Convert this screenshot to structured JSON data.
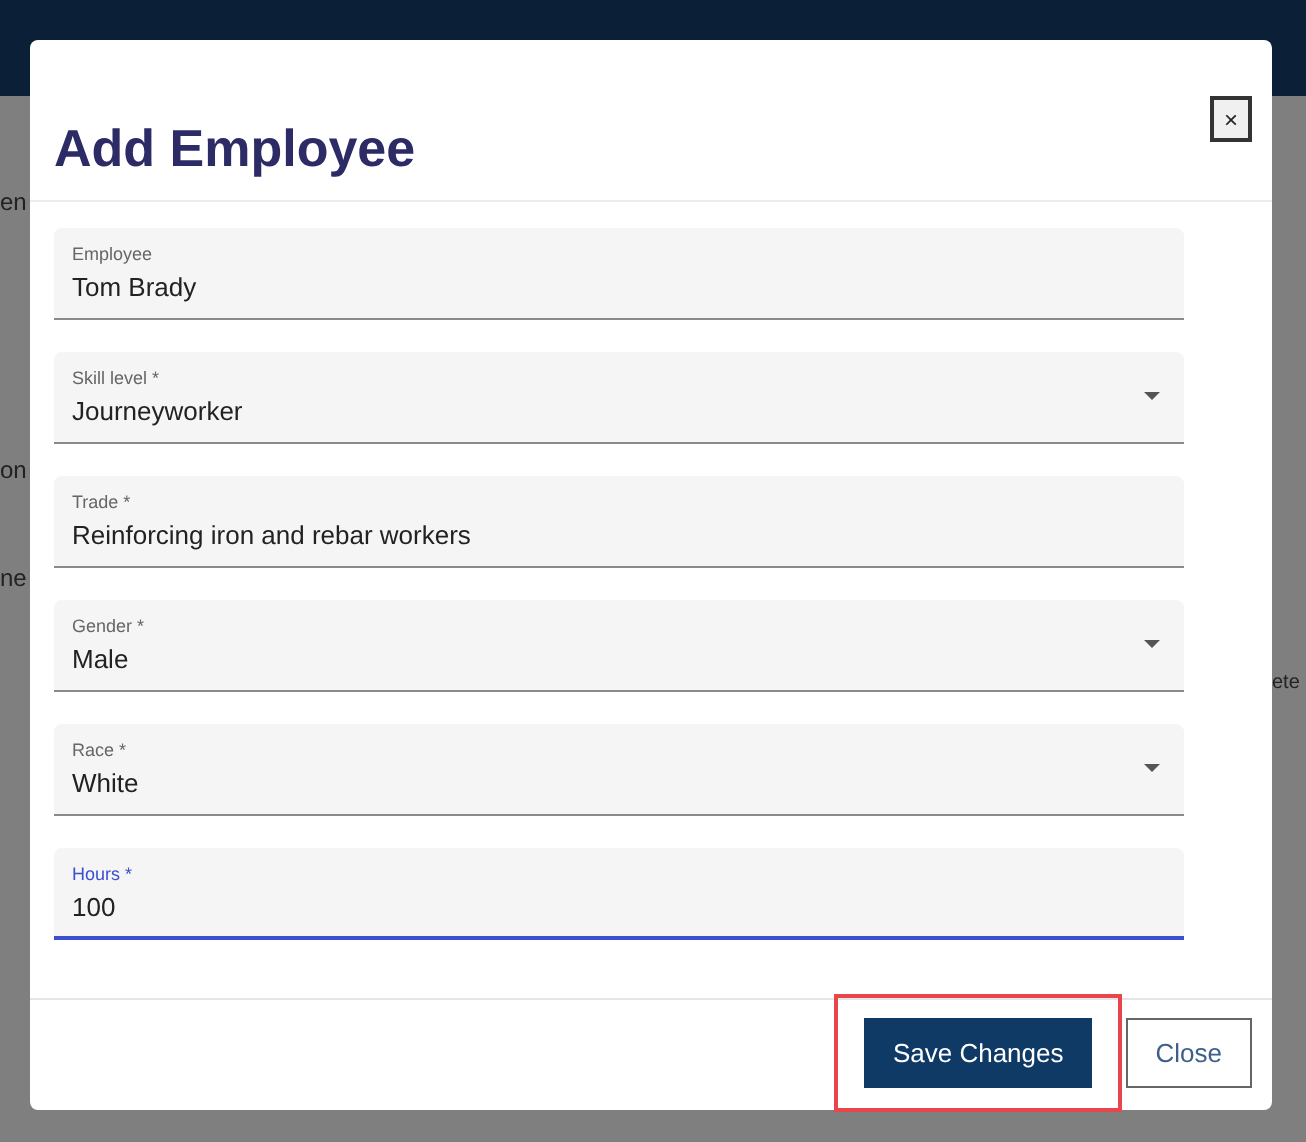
{
  "background": {
    "fragments": [
      "en",
      "on",
      "ne",
      "ete"
    ]
  },
  "dialog": {
    "title": "Add Employee",
    "close_symbol": "×",
    "fields": [
      {
        "label": "Employee",
        "value": "Tom Brady",
        "kind": "text",
        "focused": false
      },
      {
        "label": "Skill level *",
        "value": "Journeyworker",
        "kind": "select",
        "focused": false
      },
      {
        "label": "Trade *",
        "value": "Reinforcing iron and rebar workers",
        "kind": "text",
        "focused": false
      },
      {
        "label": "Gender *",
        "value": "Male",
        "kind": "select",
        "focused": false
      },
      {
        "label": "Race *",
        "value": "White",
        "kind": "select",
        "focused": false
      },
      {
        "label": "Hours *",
        "value": "100",
        "kind": "text",
        "focused": true
      }
    ],
    "buttons": [
      {
        "label": "Save Changes",
        "kind": "primary",
        "highlighted": true
      },
      {
        "label": "Close",
        "kind": "secondary",
        "highlighted": false
      }
    ]
  }
}
